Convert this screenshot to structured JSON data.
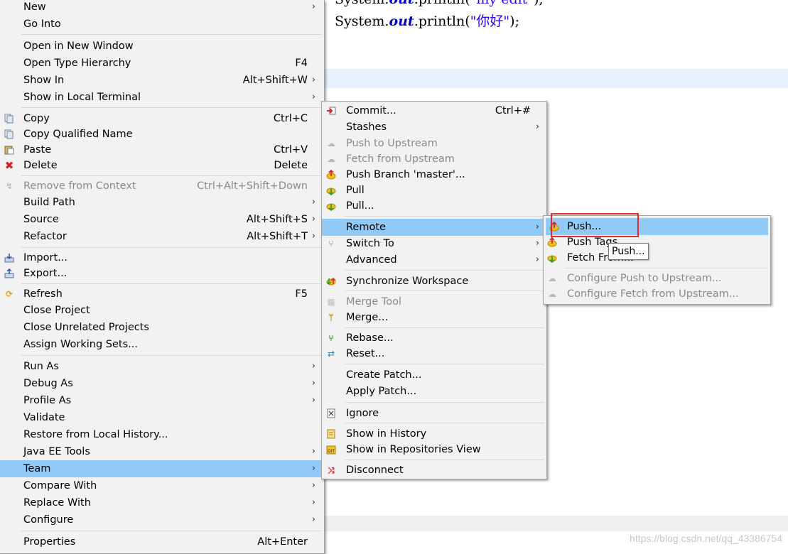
{
  "editor": {
    "code_line1_prefix": "System.",
    "code_line1_kw": "out",
    "code_line1_mid": ".println(",
    "code_line1_str": "\"my edit\"",
    "code_line1_suffix": ");",
    "code_line2_prefix": "System.",
    "code_line2_kw": "out",
    "code_line2_mid": ".println(",
    "code_line2_str": "\"你好\"",
    "code_line2_suffix": ");",
    "watermark": "https://blog.csdn.net/qq_43386754"
  },
  "context_menu": {
    "items": [
      {
        "label": "New",
        "submenu": true
      },
      {
        "label": "Go Into"
      },
      {
        "label": "Open in New Window"
      },
      {
        "label": "Open Type Hierarchy",
        "accel": "F4"
      },
      {
        "label": "Show In",
        "accel": "Alt+Shift+W",
        "submenu": true
      },
      {
        "label": "Show in Local Terminal",
        "submenu": true
      },
      {
        "label": "Copy",
        "accel": "Ctrl+C",
        "icon": "copy-icon"
      },
      {
        "label": "Copy Qualified Name",
        "icon": "copy-qualified-name-icon"
      },
      {
        "label": "Paste",
        "accel": "Ctrl+V",
        "icon": "paste-icon"
      },
      {
        "label": "Delete",
        "accel": "Delete",
        "icon": "delete-icon"
      },
      {
        "label": "Remove from Context",
        "accel": "Ctrl+Alt+Shift+Down",
        "disabled": true,
        "icon": "remove-context-icon"
      },
      {
        "label": "Build Path",
        "submenu": true
      },
      {
        "label": "Source",
        "accel": "Alt+Shift+S",
        "submenu": true
      },
      {
        "label": "Refactor",
        "accel": "Alt+Shift+T",
        "submenu": true
      },
      {
        "label": "Import...",
        "icon": "import-icon"
      },
      {
        "label": "Export...",
        "icon": "export-icon"
      },
      {
        "label": "Refresh",
        "accel": "F5",
        "icon": "refresh-icon"
      },
      {
        "label": "Close Project"
      },
      {
        "label": "Close Unrelated Projects"
      },
      {
        "label": "Assign Working Sets..."
      },
      {
        "label": "Run As",
        "submenu": true
      },
      {
        "label": "Debug As",
        "submenu": true
      },
      {
        "label": "Profile As",
        "submenu": true
      },
      {
        "label": "Validate"
      },
      {
        "label": "Restore from Local History..."
      },
      {
        "label": "Java EE Tools",
        "submenu": true
      },
      {
        "label": "Team",
        "submenu": true,
        "selected": true
      },
      {
        "label": "Compare With",
        "submenu": true
      },
      {
        "label": "Replace With",
        "submenu": true
      },
      {
        "label": "Configure",
        "submenu": true
      },
      {
        "label": "Properties",
        "accel": "Alt+Enter"
      }
    ]
  },
  "team_menu": {
    "items": [
      {
        "label": "Commit...",
        "accel": "Ctrl+#",
        "icon": "commit-icon"
      },
      {
        "label": "Stashes",
        "submenu": true
      },
      {
        "label": "Push to Upstream",
        "disabled": true,
        "icon": "push-upstream-icon"
      },
      {
        "label": "Fetch from Upstream",
        "disabled": true,
        "icon": "fetch-upstream-icon"
      },
      {
        "label": "Push Branch 'master'...",
        "icon": "push-branch-icon"
      },
      {
        "label": "Pull",
        "icon": "pull-icon"
      },
      {
        "label": "Pull...",
        "icon": "pull-dialog-icon"
      },
      {
        "label": "Remote",
        "submenu": true,
        "selected": true
      },
      {
        "label": "Switch To",
        "submenu": true,
        "icon": "switch-branch-icon"
      },
      {
        "label": "Advanced",
        "submenu": true
      },
      {
        "label": "Synchronize Workspace",
        "icon": "synchronize-icon"
      },
      {
        "label": "Merge Tool",
        "disabled": true,
        "icon": "merge-tool-icon"
      },
      {
        "label": "Merge...",
        "icon": "merge-icon"
      },
      {
        "label": "Rebase...",
        "icon": "rebase-icon"
      },
      {
        "label": "Reset...",
        "icon": "reset-icon"
      },
      {
        "label": "Create Patch..."
      },
      {
        "label": "Apply Patch..."
      },
      {
        "label": "Ignore",
        "icon": "ignore-icon"
      },
      {
        "label": "Show in History",
        "icon": "history-icon"
      },
      {
        "label": "Show in Repositories View",
        "icon": "repositories-icon"
      },
      {
        "label": "Disconnect",
        "icon": "disconnect-icon"
      }
    ]
  },
  "remote_menu": {
    "items": [
      {
        "label": "Push...",
        "selected": true,
        "icon": "push-icon"
      },
      {
        "label": "Push Tags...",
        "icon": "push-tags-icon"
      },
      {
        "label": "Fetch From...",
        "icon": "fetch-icon"
      },
      {
        "label": "Configure Push to Upstream...",
        "disabled": true,
        "icon": "configure-push-icon"
      },
      {
        "label": "Configure Fetch from Upstream...",
        "disabled": true,
        "icon": "configure-fetch-icon"
      }
    ],
    "tooltip": "Push..."
  },
  "colors": {
    "selection": "#91c9f7",
    "menu_bg": "#f2f2f2",
    "highlight_box": "#e8282d",
    "code_keyword": "#0000c0",
    "code_string": "#2a00ff"
  }
}
